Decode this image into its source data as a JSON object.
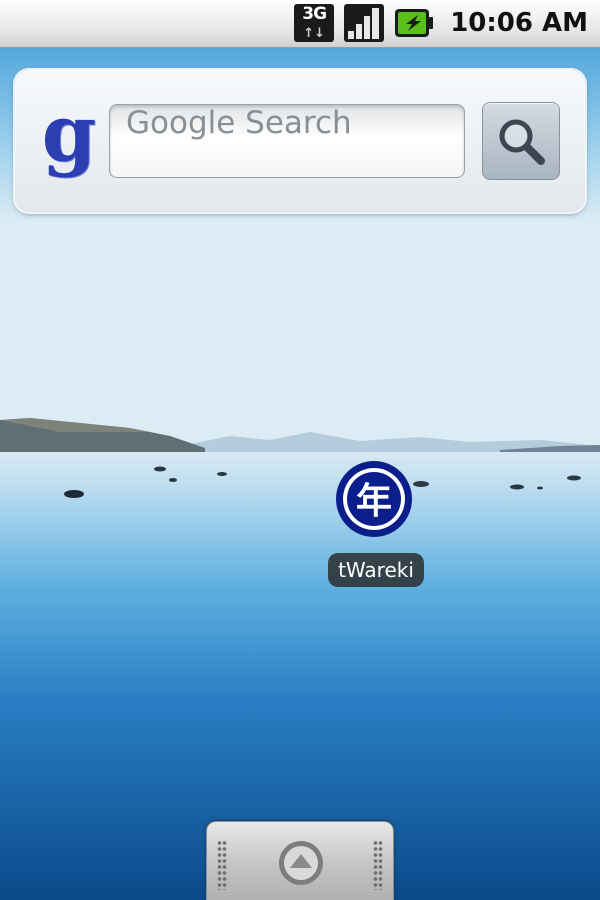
{
  "status_bar": {
    "network_type": "3G",
    "network_arrows": "↑↓",
    "clock": "10:06 AM"
  },
  "search_widget": {
    "logo_letter": "g",
    "placeholder": "Google Search"
  },
  "apps": [
    {
      "label": "tWareki",
      "icon_glyph": "年",
      "icon_color": "#0a1f8c"
    }
  ],
  "icons": {
    "network": "network-3g-icon",
    "signal": "signal-strength-icon",
    "battery": "battery-charging-icon",
    "search": "magnifier-icon",
    "drawer": "chevron-up-icon"
  },
  "colors": {
    "status_bar_bg": "#e6e6e6",
    "battery_green": "#5bbf1a",
    "google_blue": "#2b3fb3",
    "wallpaper_sky": "#3aa3dc",
    "wallpaper_water": "#0b4f8e"
  }
}
